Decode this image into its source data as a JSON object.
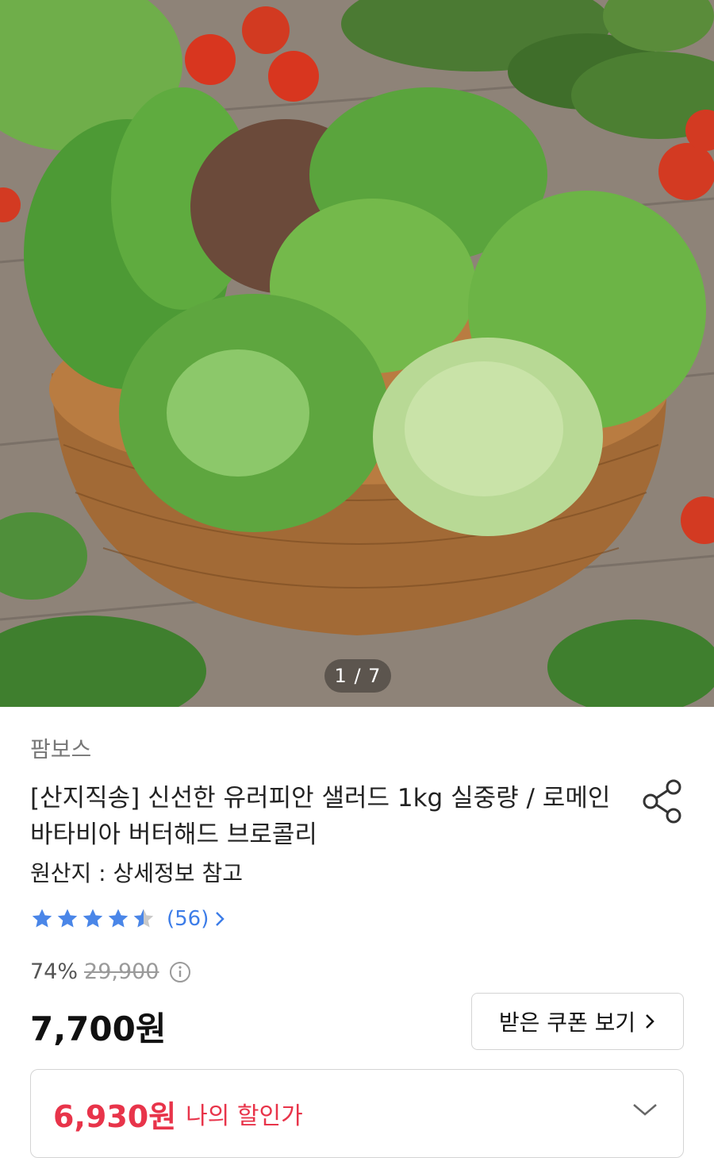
{
  "hero": {
    "image_subject": "salad-greens-basket-photo",
    "counter": "1 / 7"
  },
  "product": {
    "seller": "팜보스",
    "title": "[산지직송] 신선한 유러피안 샐러드 1kg 실중량 / 로메인 바타비아 버터해드 브로콜리",
    "origin": "원산지 : 상세정보 참고",
    "rating": {
      "stars": 4.5,
      "count_label": "(56)"
    },
    "discount_rate": "74%",
    "original_price": "29,900",
    "price": "7,700원",
    "coupon_button": "받은 쿠폰 보기",
    "my_discount": {
      "price": "6,930원",
      "label": "나의 할인가"
    }
  },
  "colors": {
    "accent_red": "#e8344a",
    "rating_blue": "#3d7de8",
    "star_fill": "#4a86e8"
  },
  "icons": [
    "share-icon",
    "star-icon",
    "chevron-right-icon",
    "info-icon",
    "chevron-down-icon"
  ]
}
